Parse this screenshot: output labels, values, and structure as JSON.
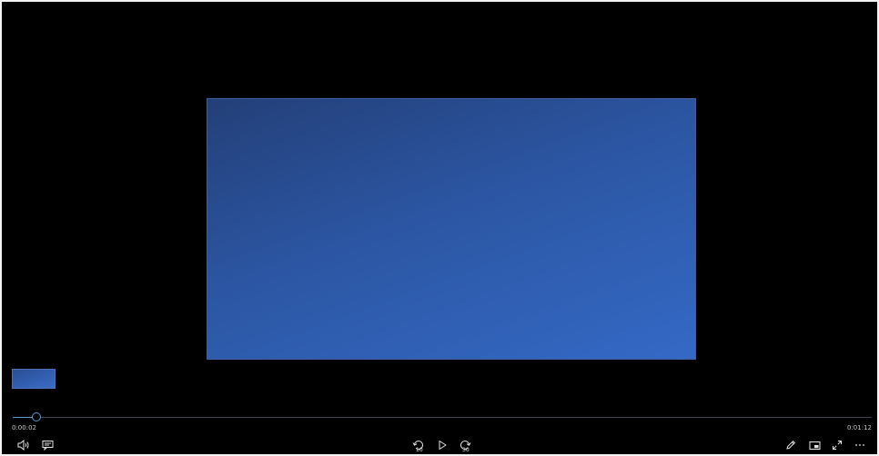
{
  "player": {
    "elapsed_time": "0:00:02",
    "total_time": "0:01:12",
    "progress": 0.028,
    "skip_back_label": "10",
    "skip_forward_label": "30"
  },
  "controls": {
    "left": [
      "volume-icon",
      "captions-icon"
    ],
    "center": [
      "skip-back-10-icon",
      "play-icon",
      "skip-forward-30-icon"
    ],
    "right": [
      "edit-pen-icon",
      "mini-view-icon",
      "fullscreen-icon",
      "more-options-icon"
    ]
  },
  "colors": {
    "background": "#000000",
    "accent": "#5b9bd5",
    "slide_light": "#3469c6",
    "slide_dark": "#233f78"
  }
}
